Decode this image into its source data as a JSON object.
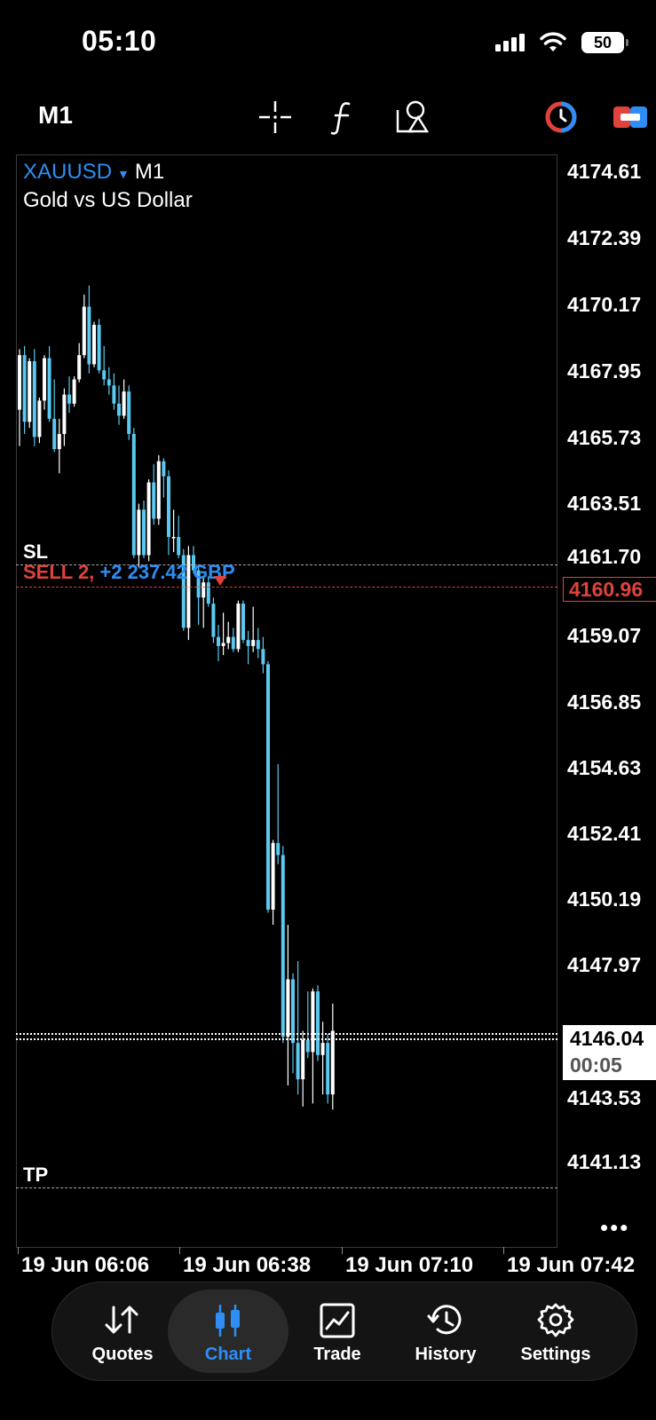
{
  "status_bar": {
    "time": "05:10",
    "battery": "50"
  },
  "toolbar": {
    "timeframe": "M1"
  },
  "chart": {
    "symbol": "XAUUSD",
    "timeframe": "M1",
    "description": "Gold vs US Dollar",
    "price_labels": [
      "4174.61",
      "4172.39",
      "4170.17",
      "4167.95",
      "4165.73",
      "4163.51",
      "4161.70",
      "4159.07",
      "4156.85",
      "4154.63",
      "4152.41",
      "4150.19",
      "4147.97",
      "4143.53",
      "4141.13"
    ],
    "open_price": "4160.96",
    "current_price": "4146.04",
    "countdown": "00:05",
    "sl_label": "SL",
    "tp_label": "TP",
    "trade_sell": "SELL 2,",
    "trade_profit": "+2 237.42 GBP",
    "time_labels": [
      "19 Jun 06:06",
      "19 Jun 06:38",
      "19 Jun 07:10",
      "19 Jun 07:42"
    ],
    "more": "•••",
    "colors": {
      "bull": "#ffffff",
      "bear": "#5ac8ef",
      "sell": "#e0433b",
      "accent": "#2e8ef5"
    }
  },
  "chart_data": {
    "type": "candlestick",
    "symbol": "XAUUSD",
    "timeframe": "M1",
    "ylim": [
      4141.13,
      4174.61
    ],
    "levels": {
      "sl": 4161.7,
      "open": 4160.96,
      "current": 4146.04,
      "tp": 4141.13
    },
    "candles": [
      {
        "o": 4166.8,
        "h": 4168.8,
        "l": 4165.6,
        "c": 4168.6
      },
      {
        "o": 4168.6,
        "h": 4168.9,
        "l": 4166.0,
        "c": 4166.4
      },
      {
        "o": 4166.4,
        "h": 4168.5,
        "l": 4166.2,
        "c": 4168.4
      },
      {
        "o": 4168.4,
        "h": 4168.8,
        "l": 4165.6,
        "c": 4165.9
      },
      {
        "o": 4165.9,
        "h": 4167.2,
        "l": 4165.7,
        "c": 4167.1
      },
      {
        "o": 4167.1,
        "h": 4168.6,
        "l": 4166.8,
        "c": 4168.5
      },
      {
        "o": 4168.5,
        "h": 4168.9,
        "l": 4166.4,
        "c": 4166.5
      },
      {
        "o": 4166.5,
        "h": 4167.8,
        "l": 4165.4,
        "c": 4165.5
      },
      {
        "o": 4165.5,
        "h": 4166.5,
        "l": 4164.7,
        "c": 4166.0
      },
      {
        "o": 4166.0,
        "h": 4167.5,
        "l": 4165.6,
        "c": 4167.3
      },
      {
        "o": 4167.3,
        "h": 4167.9,
        "l": 4166.7,
        "c": 4167.0
      },
      {
        "o": 4167.0,
        "h": 4167.9,
        "l": 4166.9,
        "c": 4167.8
      },
      {
        "o": 4167.8,
        "h": 4169.0,
        "l": 4167.7,
        "c": 4168.6
      },
      {
        "o": 4168.6,
        "h": 4170.6,
        "l": 4168.5,
        "c": 4170.2
      },
      {
        "o": 4170.2,
        "h": 4170.9,
        "l": 4168.0,
        "c": 4168.3
      },
      {
        "o": 4168.3,
        "h": 4169.7,
        "l": 4168.2,
        "c": 4169.6
      },
      {
        "o": 4169.6,
        "h": 4169.8,
        "l": 4168.0,
        "c": 4168.1
      },
      {
        "o": 4168.1,
        "h": 4168.9,
        "l": 4167.6,
        "c": 4167.8
      },
      {
        "o": 4167.8,
        "h": 4168.2,
        "l": 4167.3,
        "c": 4167.6
      },
      {
        "o": 4167.6,
        "h": 4168.0,
        "l": 4166.8,
        "c": 4167.0
      },
      {
        "o": 4167.0,
        "h": 4167.6,
        "l": 4166.3,
        "c": 4166.6
      },
      {
        "o": 4166.6,
        "h": 4167.8,
        "l": 4166.5,
        "c": 4167.4
      },
      {
        "o": 4167.4,
        "h": 4167.6,
        "l": 4165.8,
        "c": 4166.0
      },
      {
        "o": 4166.0,
        "h": 4166.2,
        "l": 4161.9,
        "c": 4162.0
      },
      {
        "o": 4162.0,
        "h": 4163.7,
        "l": 4161.6,
        "c": 4163.5
      },
      {
        "o": 4163.5,
        "h": 4163.8,
        "l": 4161.9,
        "c": 4162.0
      },
      {
        "o": 4162.0,
        "h": 4164.5,
        "l": 4161.8,
        "c": 4164.4
      },
      {
        "o": 4164.4,
        "h": 4165.0,
        "l": 4163.0,
        "c": 4163.2
      },
      {
        "o": 4163.2,
        "h": 4165.3,
        "l": 4163.0,
        "c": 4165.1
      },
      {
        "o": 4165.1,
        "h": 4165.2,
        "l": 4163.9,
        "c": 4164.6
      },
      {
        "o": 4164.6,
        "h": 4164.8,
        "l": 4162.0,
        "c": 4162.6
      },
      {
        "o": 4162.6,
        "h": 4163.5,
        "l": 4162.1,
        "c": 4162.6
      },
      {
        "o": 4162.6,
        "h": 4163.3,
        "l": 4161.9,
        "c": 4162.0
      },
      {
        "o": 4162.0,
        "h": 4162.2,
        "l": 4159.5,
        "c": 4159.6
      },
      {
        "o": 4159.6,
        "h": 4162.3,
        "l": 4159.2,
        "c": 4162.0
      },
      {
        "o": 4162.0,
        "h": 4162.3,
        "l": 4161.4,
        "c": 4161.5
      },
      {
        "o": 4161.5,
        "h": 4161.7,
        "l": 4159.7,
        "c": 4160.6
      },
      {
        "o": 4160.6,
        "h": 4161.3,
        "l": 4159.6,
        "c": 4161.1
      },
      {
        "o": 4161.1,
        "h": 4161.3,
        "l": 4160.3,
        "c": 4160.4
      },
      {
        "o": 4160.4,
        "h": 4160.6,
        "l": 4159.1,
        "c": 4159.3
      },
      {
        "o": 4159.3,
        "h": 4159.7,
        "l": 4158.5,
        "c": 4159.0
      },
      {
        "o": 4159.0,
        "h": 4160.1,
        "l": 4158.7,
        "c": 4159.1
      },
      {
        "o": 4159.1,
        "h": 4159.8,
        "l": 4158.9,
        "c": 4159.3
      },
      {
        "o": 4159.3,
        "h": 4159.6,
        "l": 4158.8,
        "c": 4158.9
      },
      {
        "o": 4158.9,
        "h": 4160.5,
        "l": 4158.8,
        "c": 4160.4
      },
      {
        "o": 4160.4,
        "h": 4160.5,
        "l": 4159.1,
        "c": 4159.2
      },
      {
        "o": 4159.2,
        "h": 4159.5,
        "l": 4158.4,
        "c": 4159.0
      },
      {
        "o": 4159.0,
        "h": 4160.3,
        "l": 4158.8,
        "c": 4159.2
      },
      {
        "o": 4159.2,
        "h": 4159.6,
        "l": 4158.6,
        "c": 4158.9
      },
      {
        "o": 4158.9,
        "h": 4159.3,
        "l": 4158.1,
        "c": 4158.4
      },
      {
        "o": 4158.4,
        "h": 4158.5,
        "l": 4150.2,
        "c": 4150.3
      },
      {
        "o": 4150.3,
        "h": 4152.6,
        "l": 4149.8,
        "c": 4152.5
      },
      {
        "o": 4152.5,
        "h": 4155.1,
        "l": 4151.8,
        "c": 4152.1
      },
      {
        "o": 4152.1,
        "h": 4152.4,
        "l": 4145.9,
        "c": 4146.1
      },
      {
        "o": 4146.1,
        "h": 4149.8,
        "l": 4144.5,
        "c": 4148.0
      },
      {
        "o": 4148.0,
        "h": 4148.2,
        "l": 4144.9,
        "c": 4145.9
      },
      {
        "o": 4145.9,
        "h": 4148.6,
        "l": 4144.2,
        "c": 4144.7
      },
      {
        "o": 4144.7,
        "h": 4146.3,
        "l": 4143.8,
        "c": 4146.0
      },
      {
        "o": 4146.0,
        "h": 4147.6,
        "l": 4145.4,
        "c": 4145.6
      },
      {
        "o": 4145.6,
        "h": 4147.7,
        "l": 4143.9,
        "c": 4147.6
      },
      {
        "o": 4147.6,
        "h": 4147.8,
        "l": 4145.3,
        "c": 4145.5
      },
      {
        "o": 4145.5,
        "h": 4146.6,
        "l": 4144.2,
        "c": 4145.9
      },
      {
        "o": 4145.9,
        "h": 4146.2,
        "l": 4143.9,
        "c": 4144.2
      },
      {
        "o": 4144.2,
        "h": 4147.2,
        "l": 4143.7,
        "c": 4146.3
      }
    ]
  },
  "nav": {
    "quotes": "Quotes",
    "chart": "Chart",
    "trade": "Trade",
    "history": "History",
    "settings": "Settings"
  }
}
